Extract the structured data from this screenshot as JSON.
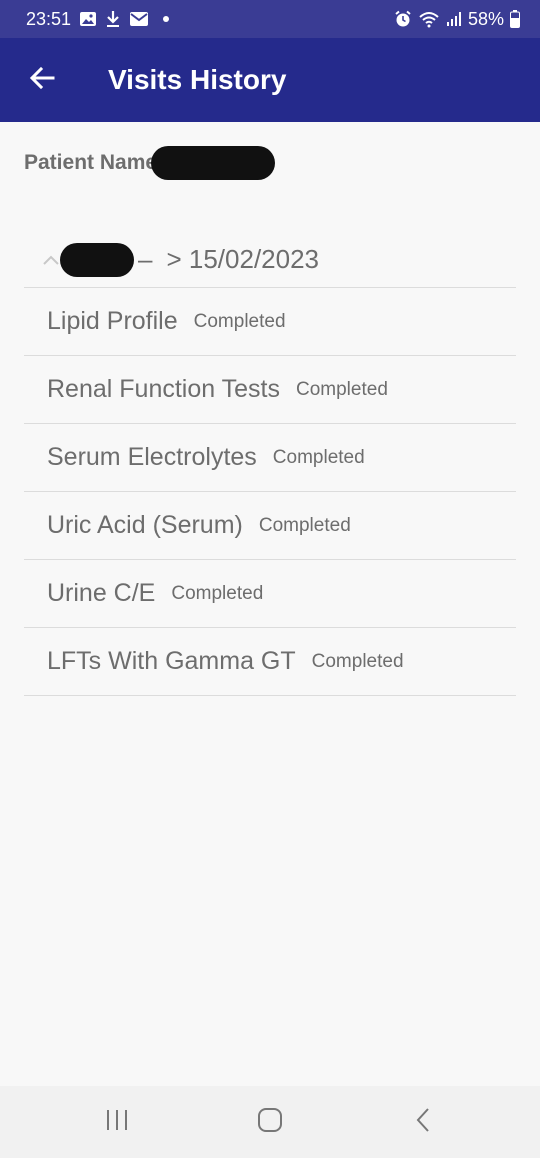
{
  "status_bar": {
    "time": "23:51",
    "battery": "58%",
    "icons": [
      "image-icon",
      "download-icon",
      "mail-icon",
      "alarm-icon",
      "wifi-icon",
      "signal-icon",
      "battery-icon"
    ]
  },
  "app_bar": {
    "title": "Visits History",
    "back_icon": "arrow-left-icon"
  },
  "patient": {
    "label": "Patient Name"
  },
  "visit": {
    "dash": "–",
    "date": "> 15/02/2023",
    "expanded_icon": "chevron-up-icon",
    "tests": [
      {
        "name": "Lipid Profile",
        "status": "Completed"
      },
      {
        "name": "Renal Function Tests",
        "status": "Completed"
      },
      {
        "name": "Serum Electrolytes",
        "status": "Completed"
      },
      {
        "name": "Uric Acid (Serum)",
        "status": "Completed"
      },
      {
        "name": "Urine C/E",
        "status": "Completed"
      },
      {
        "name": "LFTs With Gamma GT",
        "status": "Completed"
      }
    ]
  },
  "nav_bar": {
    "icons": [
      "recent-apps-icon",
      "home-icon",
      "back-icon"
    ]
  },
  "colors": {
    "status_bar": "#3a3c94",
    "app_bar": "#252a8c",
    "background": "#f8f8f8",
    "text_gray": "#6d6d6d"
  }
}
